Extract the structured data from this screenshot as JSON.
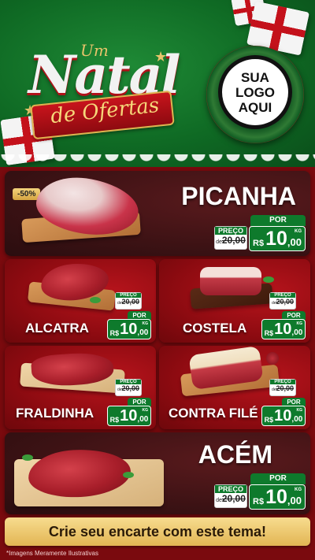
{
  "header": {
    "title_small": "Um",
    "title_big": "Natal",
    "title_ribbon": "de Ofertas",
    "logo_lines": [
      "SUA",
      "LOGO",
      "AQUI"
    ]
  },
  "products": [
    {
      "name": "PICANHA",
      "badge": "-50%",
      "de_label": "PREÇO",
      "de_prefix": "de",
      "old_price": "20,00",
      "por_label": "POR",
      "currency": "R$",
      "price_int": "10",
      "price_dec": ",00",
      "unit": "KG"
    },
    {
      "name": "ALCATRA",
      "de_label": "PREÇO",
      "de_prefix": "de",
      "old_price": "20,00",
      "por_label": "POR",
      "currency": "R$",
      "price_int": "10",
      "price_dec": ",00",
      "unit": "KG"
    },
    {
      "name": "COSTELA",
      "de_label": "PREÇO",
      "de_prefix": "de",
      "old_price": "20,00",
      "por_label": "POR",
      "currency": "R$",
      "price_int": "10",
      "price_dec": ",00",
      "unit": "KG"
    },
    {
      "name": "FRALDINHA",
      "de_label": "PREÇO",
      "de_prefix": "de",
      "old_price": "20,00",
      "por_label": "POR",
      "currency": "R$",
      "price_int": "10",
      "price_dec": ",00",
      "unit": "KG"
    },
    {
      "name": "CONTRA FILÉ",
      "de_label": "PREÇO",
      "de_prefix": "de",
      "old_price": "20,00",
      "por_label": "POR",
      "currency": "R$",
      "price_int": "10",
      "price_dec": ",00",
      "unit": "KG"
    },
    {
      "name": "ACÉM",
      "de_label": "PREÇO",
      "de_prefix": "de",
      "old_price": "20,00",
      "por_label": "POR",
      "currency": "R$",
      "price_int": "10",
      "price_dec": ",00",
      "unit": "KG"
    }
  ],
  "cta": "Crie seu encarte com este tema!",
  "disclaimer": "*Imagens Meramente Ilustrativas",
  "colors": {
    "green": "#0e7a2c",
    "red": "#b7141c",
    "gold": "#e2b553"
  }
}
